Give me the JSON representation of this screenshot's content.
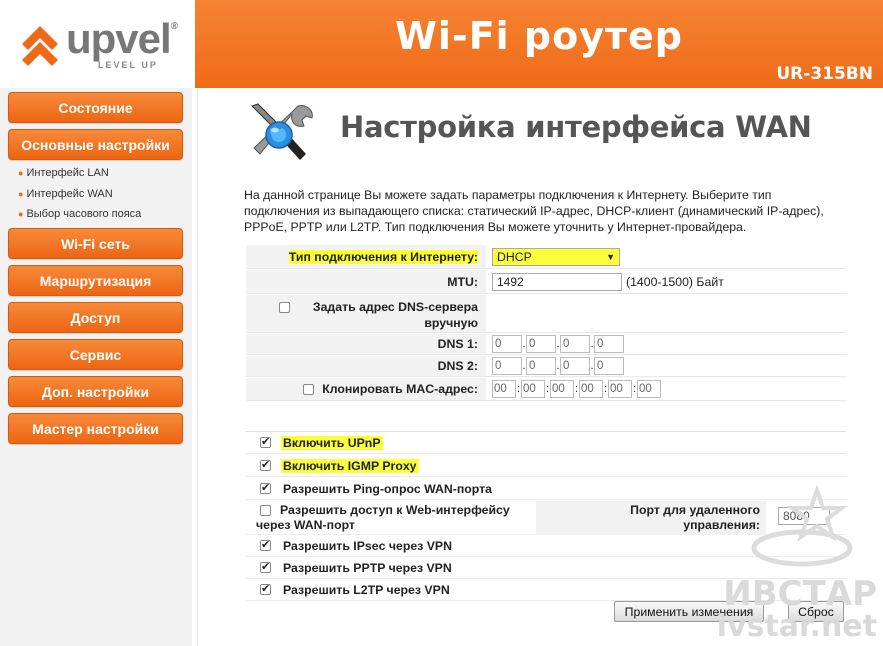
{
  "brand": {
    "name": "upvel",
    "tagline": "LEVEL UP",
    "color": "#ee6a18"
  },
  "header": {
    "title": "Wi-Fi роутер",
    "model": "UR-315BN"
  },
  "sidebar": {
    "menu": [
      {
        "label": "Состояние"
      },
      {
        "label": "Основные настройки"
      },
      {
        "label": "Wi-Fi сеть"
      },
      {
        "label": "Маршрутизация"
      },
      {
        "label": "Доступ"
      },
      {
        "label": "Сервис"
      },
      {
        "label": "Доп. настройки"
      },
      {
        "label": "Мастер настройки"
      }
    ],
    "submenu": [
      {
        "label": "Интерфейс LAN"
      },
      {
        "label": "Интерфейс WAN"
      },
      {
        "label": "Выбор часового пояса"
      }
    ]
  },
  "page": {
    "title": "Настройка интерфейса WAN",
    "description": "На данной странице Вы можете задать параметры подключения к Интернету. Выберите тип подключения из выпадающего списка: статический IP-адрес, DHCP-клиент (динамический IP-адрес), PPPoE, PPTP или L2TP. Тип подключения Вы можете уточнить у Интернет-провайдера."
  },
  "form": {
    "connection_type": {
      "label": "Тип подключения к Интернету:",
      "value": "DHCP"
    },
    "mtu": {
      "label": "MTU:",
      "value": "1492",
      "hint": "(1400-1500) Байт"
    },
    "dns_manual": {
      "label": "Задать адрес DNS-сервера вручную",
      "checked": false
    },
    "dns1": {
      "label": "DNS 1:",
      "octets": [
        "0",
        "0",
        "0",
        "0"
      ]
    },
    "dns2": {
      "label": "DNS 2:",
      "octets": [
        "0",
        "0",
        "0",
        "0"
      ]
    },
    "clone_mac": {
      "label": "Клонировать MAC-адрес:",
      "checked": false,
      "octets": [
        "00",
        "00",
        "00",
        "00",
        "00",
        "00"
      ]
    }
  },
  "options": {
    "upnp": {
      "label": "Включить UPnP",
      "checked": true
    },
    "igmp": {
      "label": "Включить IGMP Proxy",
      "checked": true
    },
    "ping": {
      "label": "Разрешить Ping-опрос WAN-порта",
      "checked": true
    },
    "web_access": {
      "label": "Разрешить доступ к Web-интерфейсу через WAN-порт",
      "checked": false
    },
    "remote_port": {
      "label": "Порт для удаленного управления:",
      "value": "8080"
    },
    "ipsec": {
      "label": "Разрешить IPsec через VPN",
      "checked": true
    },
    "pptp": {
      "label": "Разрешить PPTP через VPN",
      "checked": true
    },
    "l2tp": {
      "label": "Разрешить L2TP через VPN",
      "checked": true
    }
  },
  "actions": {
    "apply": "Применить изменения",
    "reset": "Сброс"
  },
  "watermark": {
    "line1": "ИВСТАР",
    "line2": "ivstar.net"
  }
}
